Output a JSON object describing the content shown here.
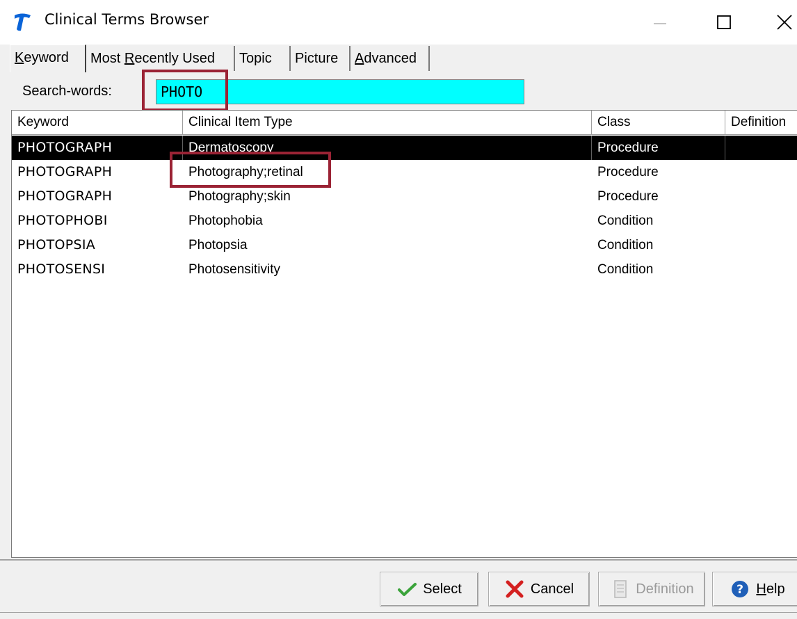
{
  "window": {
    "title": "Clinical Terms Browser",
    "minimize_glyph": "—",
    "maximize_glyph": "☐",
    "close_glyph": "✕"
  },
  "tabs": [
    {
      "label_pre": "",
      "mnemonic": "K",
      "label_post": "eyword",
      "active": true
    },
    {
      "label_pre": "Most ",
      "mnemonic": "R",
      "label_post": "ecently Used",
      "active": false
    },
    {
      "label_pre": "Topic",
      "mnemonic": "",
      "label_post": "",
      "active": false
    },
    {
      "label_pre": "Picture",
      "mnemonic": "",
      "label_post": "",
      "active": false
    },
    {
      "label_pre": "",
      "mnemonic": "A",
      "label_post": "dvanced",
      "active": false
    }
  ],
  "search": {
    "label": "Search-words:",
    "value": "PHOTO"
  },
  "grid": {
    "columns": [
      "Keyword",
      "Clinical Item Type",
      "Class",
      "Definition"
    ],
    "rows": [
      {
        "keyword": "PHOTOGRAPH",
        "type": "Dermatoscopy",
        "class": "Procedure",
        "definition": "",
        "selected": true
      },
      {
        "keyword": "PHOTOGRAPH",
        "type": "Photography;retinal",
        "class": "Procedure",
        "definition": "",
        "selected": false
      },
      {
        "keyword": "PHOTOGRAPH",
        "type": "Photography;skin",
        "class": "Procedure",
        "definition": "",
        "selected": false
      },
      {
        "keyword": "PHOTOPHOBI",
        "type": "Photophobia",
        "class": "Condition",
        "definition": "",
        "selected": false
      },
      {
        "keyword": "PHOTOPSIA",
        "type": "Photopsia",
        "class": "Condition",
        "definition": "",
        "selected": false
      },
      {
        "keyword": "PHOTOSENSI",
        "type": "Photosensitivity",
        "class": "Condition",
        "definition": "",
        "selected": false
      }
    ]
  },
  "buttons": {
    "select": "Select",
    "cancel": "Cancel",
    "definition": "Definition",
    "help_mnemonic": "H",
    "help_rest": "elp"
  },
  "colors": {
    "search_bg": "#00ffff",
    "annotation": "#9b2335",
    "selected_row": "#000000"
  }
}
